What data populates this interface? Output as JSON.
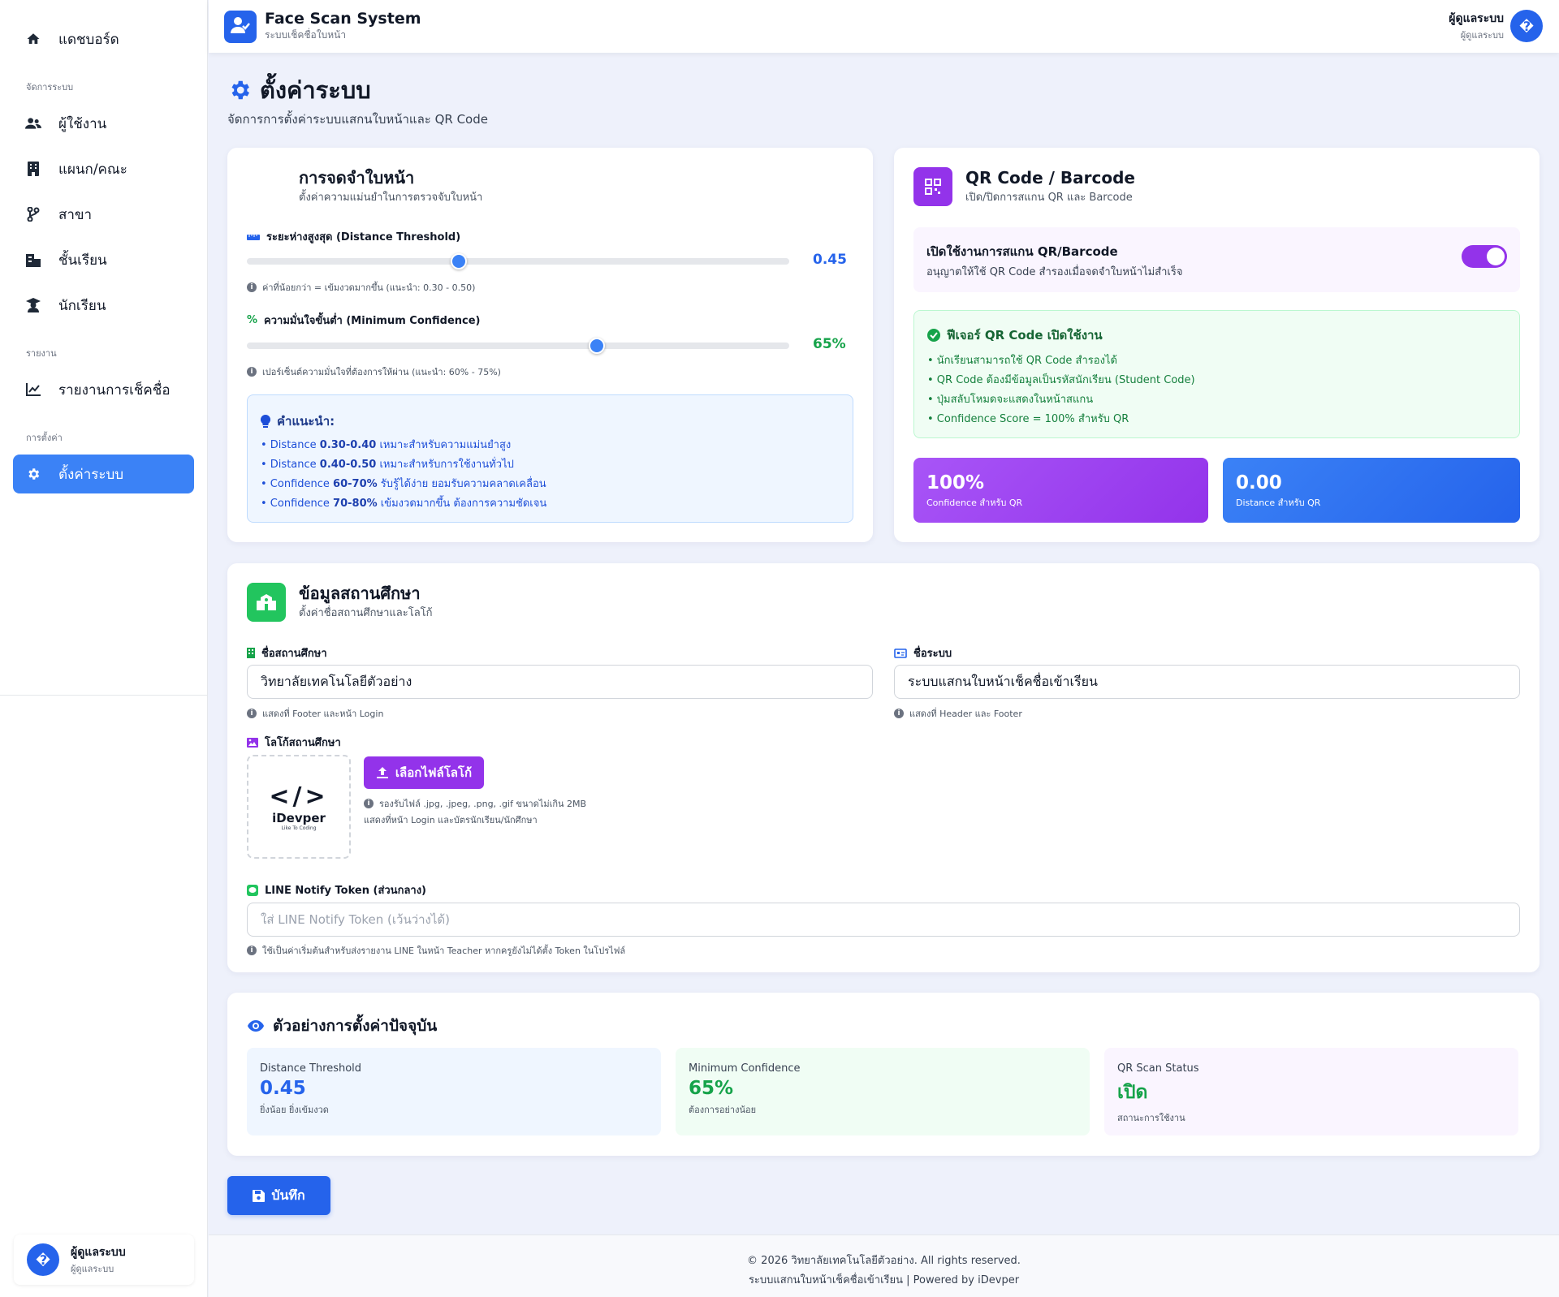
{
  "sidebar": {
    "items": [
      {
        "label": "แดชบอร์ด"
      },
      {
        "label": "ผู้ใช้งาน"
      },
      {
        "label": "แผนก/คณะ"
      },
      {
        "label": "สาขา"
      },
      {
        "label": "ชั้นเรียน"
      },
      {
        "label": "นักเรียน"
      },
      {
        "label": "รายงานการเช็คชื่อ"
      },
      {
        "label": "ตั้งค่าระบบ"
      }
    ],
    "sections": [
      "จัดการระบบ",
      "รายงาน",
      "การตั้งค่า"
    ],
    "user": {
      "name": "ผู้ดูแลระบบ",
      "role": "ผู้ดูแลระบบ",
      "avatar": "�"
    }
  },
  "header": {
    "title": "Face Scan System",
    "subtitle": "ระบบเช็คชื่อใบหน้า",
    "user_name": "ผู้ดูแลระบบ",
    "user_role": "ผู้ดูแลระบบ",
    "avatar": "�"
  },
  "page": {
    "title": "ตั้งค่าระบบ",
    "subtitle": "จัดการการตั้งค่าระบบแสกนใบหน้าและ QR Code"
  },
  "face": {
    "title": "การจดจำใบหน้า",
    "subtitle": "ตั้งค่าความแม่นยำในการตรวจจับใบหน้า",
    "distance_label": "ระยะห่างสูงสุด (Distance Threshold)",
    "distance_value": "0.45",
    "distance_fraction": 0.39,
    "distance_hint": "ค่าที่น้อยกว่า = เข้มงวดมากขึ้น (แนะนำ: 0.30 - 0.50)",
    "confidence_label": "ความมั่นใจขั้นต่ำ (Minimum Confidence)",
    "confidence_value": "65%",
    "confidence_fraction": 0.645,
    "confidence_hint": "เปอร์เซ็นต์ความมั่นใจที่ต้องการให้ผ่าน (แนะนำ: 60% - 75%)",
    "tips_title": "คำแนะนำ:",
    "tips": [
      {
        "pre": "• Distance ",
        "bold": "0.30-0.40",
        "post": " เหมาะสำหรับความแม่นยำสูง"
      },
      {
        "pre": "• Distance ",
        "bold": "0.40-0.50",
        "post": " เหมาะสำหรับการใช้งานทั่วไป"
      },
      {
        "pre": "• Confidence ",
        "bold": "60-70%",
        "post": " รับรู้ได้ง่าย ยอมรับความคลาดเคลื่อน"
      },
      {
        "pre": "• Confidence ",
        "bold": "70-80%",
        "post": " เข้มงวดมากขึ้น ต้องการความชัดเจน"
      }
    ]
  },
  "qr": {
    "title": "QR Code / Barcode",
    "subtitle": "เปิด/ปิดการสแกน QR และ Barcode",
    "toggle_title": "เปิดใช้งานการสแกน QR/Barcode",
    "toggle_sub": "อนุญาตให้ใช้ QR Code สำรองเมื่อจดจำใบหน้าไม่สำเร็จ",
    "enabled": true,
    "feature_title": "ฟีเจอร์ QR Code เปิดใช้งาน",
    "features": [
      "• นักเรียนสามารถใช้ QR Code สำรองได้",
      "• QR Code ต้องมีข้อมูลเป็นรหัสนักเรียน (Student Code)",
      "• ปุ่มสลับโหมดจะแสดงในหน้าสแกน",
      "• Confidence Score = 100% สำหรับ QR"
    ],
    "stat1_value": "100%",
    "stat1_label": "Confidence สำหรับ QR",
    "stat2_value": "0.00",
    "stat2_label": "Distance สำหรับ QR"
  },
  "school": {
    "title": "ข้อมูลสถานศึกษา",
    "subtitle": "ตั้งค่าชื่อสถานศึกษาและโลโก้",
    "name_label": "ชื่อสถานศึกษา",
    "name_value": "วิทยาลัยเทคโนโลยีตัวอย่าง",
    "name_hint": "แสดงที่ Footer และหน้า Login",
    "system_label": "ชื่อระบบ",
    "system_value": "ระบบแสกนใบหน้าเช็คชื่อเข้าเรียน",
    "system_hint": "แสดงที่ Header และ Footer",
    "logo_label": "โลโก้สถานศึกษา",
    "logo_text": "iDevper",
    "logo_tag": "Like To Coding",
    "upload_label": "เลือกไฟล์โลโก้",
    "upload_hint1": "รองรับไฟล์ .jpg, .jpeg, .png, .gif ขนาดไม่เกิน 2MB",
    "upload_hint2": "แสดงที่หน้า Login และบัตรนักเรียน/นักศึกษา",
    "line_label": "LINE Notify Token (ส่วนกลาง)",
    "line_placeholder": "ใส่ LINE Notify Token (เว้นว่างได้)",
    "line_hint": "ใช้เป็นค่าเริ่มต้นสำหรับส่งรายงาน LINE ในหน้า Teacher หากครูยังไม่ได้ตั้ง Token ในโปรไฟล์"
  },
  "preview": {
    "title": "ตัวอย่างการตั้งค่าปัจจุบัน",
    "boxes": [
      {
        "label": "Distance Threshold",
        "value": "0.45",
        "sub": "ยิ่งน้อย ยิ่งเข้มงวด"
      },
      {
        "label": "Minimum Confidence",
        "value": "65%",
        "sub": "ต้องการอย่างน้อย"
      },
      {
        "label": "QR Scan Status",
        "value": "เปิด",
        "sub": "สถานะการใช้งาน"
      }
    ]
  },
  "save_label": "บันทึก",
  "footer": {
    "line1": "© 2026 วิทยาลัยเทคโนโลยีตัวอย่าง. All rights reserved.",
    "line2": "ระบบแสกนใบหน้าเช็คชื่อเข้าเรียน | Powered by iDevper"
  },
  "colors": {
    "primary": "#2563eb",
    "purple": "#9333ea",
    "green": "#16a34a"
  }
}
